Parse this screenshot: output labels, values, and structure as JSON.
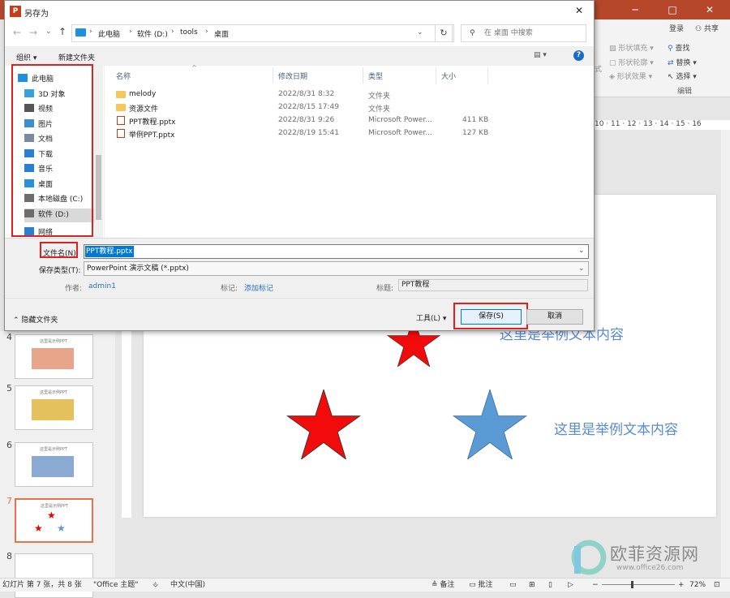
{
  "app": {
    "ribbon": {
      "login": "登录",
      "share": "共享",
      "shape_fill": "形状填充",
      "shape_outline": "形状轮廓",
      "shape_effect": "形状效果",
      "find": "查找",
      "replace": "替换",
      "select": "选择",
      "edit_group": "编辑",
      "style_cut": "式",
      "minimize": "─",
      "maximize": "□",
      "close": "✕"
    },
    "ruler_text": "10 · 11 · 12 · 13 · 14 · 15 · 16",
    "slide": {
      "text1": "这里是举例文本内容",
      "text2": "这里是举例文本内容",
      "star_red": "#f10b0b",
      "star_blue": "#5b9bd5"
    },
    "thumbnails": [
      {
        "num": "4",
        "title": "这里是示例PPT",
        "color": "#e8a58a"
      },
      {
        "num": "5",
        "title": "这里是示例PPT",
        "color": "#e4c15d"
      },
      {
        "num": "6",
        "title": "这里是示例PPT",
        "color": "#8aa9d3"
      },
      {
        "num": "7",
        "title": "这里是示例PPT",
        "color": "#ffffff"
      },
      {
        "num": "8",
        "title": "",
        "color": "#ffffff"
      }
    ],
    "statusbar": {
      "slide_info": "幻灯片 第 7 张，共 8 张",
      "theme": "\"Office 主题\"",
      "lang": "中文(中国)",
      "notes": "备注",
      "comments": "批注",
      "zoom": "72%"
    },
    "watermark": {
      "name": "欧菲资源网",
      "url": "www.office26.com"
    }
  },
  "dialog": {
    "title": "另存为",
    "close": "✕",
    "breadcrumb": [
      "此电脑",
      "软件 (D:)",
      "tools",
      "桌面"
    ],
    "search_placeholder": "在 桌面 中搜索",
    "toolbar": {
      "organize": "组织 ▾",
      "new_folder": "新建文件夹"
    },
    "nav": [
      {
        "label": "此电脑",
        "icon": "pc-icon"
      },
      {
        "label": "3D 对象",
        "icon": "3d-icon"
      },
      {
        "label": "视频",
        "icon": "video-icon"
      },
      {
        "label": "图片",
        "icon": "picture-icon"
      },
      {
        "label": "文档",
        "icon": "document-icon"
      },
      {
        "label": "下载",
        "icon": "download-icon"
      },
      {
        "label": "音乐",
        "icon": "music-icon"
      },
      {
        "label": "桌面",
        "icon": "desktop-icon"
      },
      {
        "label": "本地磁盘 (C:)",
        "icon": "drive-icon"
      },
      {
        "label": "软件 (D:)",
        "icon": "drive-icon"
      },
      {
        "label": "网络",
        "icon": "network-icon"
      }
    ],
    "columns": {
      "name": "名称",
      "date": "修改日期",
      "type": "类型",
      "size": "大小"
    },
    "files": [
      {
        "name": "melody",
        "date": "2022/8/31 8:32",
        "type": "文件夹",
        "size": "",
        "kind": "folder"
      },
      {
        "name": "资源文件",
        "date": "2022/8/15 17:49",
        "type": "文件夹",
        "size": "",
        "kind": "folder"
      },
      {
        "name": "PPT教程.pptx",
        "date": "2022/8/31 9:26",
        "type": "Microsoft Power...",
        "size": "411 KB",
        "kind": "pptx"
      },
      {
        "name": "举例PPT.pptx",
        "date": "2022/8/19 15:41",
        "type": "Microsoft Power...",
        "size": "127 KB",
        "kind": "pptx"
      }
    ],
    "filename_label": "文件名(N):",
    "filename_value": "PPT教程.pptx",
    "filetype_label": "保存类型(T):",
    "filetype_value": "PowerPoint 演示文稿 (*.pptx)",
    "author_label": "作者:",
    "author_value": "admin1",
    "tags_label": "标记:",
    "tags_value": "添加标记",
    "title_label": "标题:",
    "title_value": "PPT教程",
    "hide_folders": "隐藏文件夹",
    "tools": "工具(L)",
    "save": "保存(S)",
    "cancel": "取消"
  }
}
